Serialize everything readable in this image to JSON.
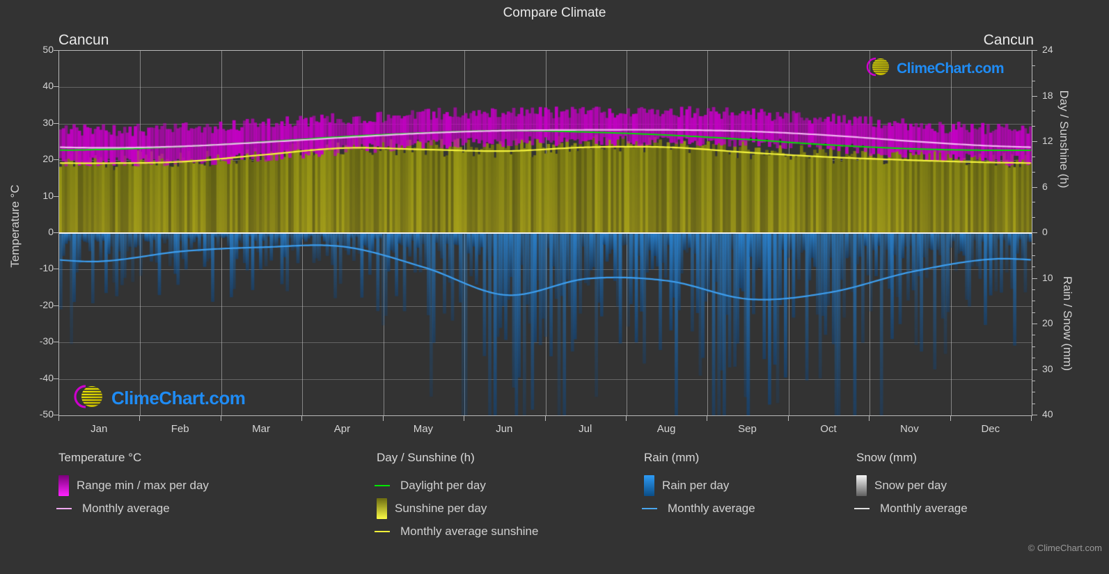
{
  "header": {
    "title": "Compare Climate",
    "city_left": "Cancun",
    "city_right": "Cancun"
  },
  "axes": {
    "left_title": "Temperature °C",
    "right_top_title": "Day / Sunshine (h)",
    "right_bottom_title": "Rain / Snow (mm)",
    "left_ticks": [
      "50",
      "40",
      "30",
      "20",
      "10",
      "0",
      "-10",
      "-20",
      "-30",
      "-40",
      "-50"
    ],
    "right_top_ticks": [
      "24",
      "18",
      "12",
      "6",
      "0"
    ],
    "right_bottom_ticks": [
      "0",
      "10",
      "20",
      "30",
      "40"
    ],
    "x_ticks": [
      "Jan",
      "Feb",
      "Mar",
      "Apr",
      "May",
      "Jun",
      "Jul",
      "Aug",
      "Sep",
      "Oct",
      "Nov",
      "Dec"
    ]
  },
  "legend": {
    "columns": [
      {
        "heading": "Temperature °C",
        "entries": [
          {
            "label": "Range min / max per day",
            "style": "box",
            "color": "#cc00cc"
          },
          {
            "label": "Monthly average",
            "style": "line",
            "color": "#f0a8f0"
          }
        ]
      },
      {
        "heading": "Day / Sunshine (h)",
        "entries": [
          {
            "label": "Daylight per day",
            "style": "line",
            "color": "#00e800"
          },
          {
            "label": "Sunshine per day",
            "style": "box",
            "color": "#eaea22"
          },
          {
            "label": "Monthly average sunshine",
            "style": "line",
            "color": "#f2f23a"
          }
        ]
      },
      {
        "heading": "Rain (mm)",
        "entries": [
          {
            "label": "Rain per day",
            "style": "box",
            "color": "#1a86e0"
          },
          {
            "label": "Monthly average",
            "style": "line",
            "color": "#4aa6ee"
          }
        ]
      },
      {
        "heading": "Snow (mm)",
        "entries": [
          {
            "label": "Snow per day",
            "style": "box",
            "color": "#e8e8e8"
          },
          {
            "label": "Monthly average",
            "style": "line",
            "color": "#e0e0e0"
          }
        ]
      }
    ],
    "copyright": "© ClimeChart.com"
  },
  "branding": {
    "logo_text": "ClimeChart.com",
    "logo_ring_color": "#cc00cc",
    "logo_sphere_color": "#e0e000",
    "logo_text_color": "#1f8cf5"
  },
  "chart_data": {
    "type": "area",
    "title": "Compare Climate",
    "location": "Cancun",
    "xlabel": "",
    "categories": [
      "Jan",
      "Feb",
      "Mar",
      "Apr",
      "May",
      "Jun",
      "Jul",
      "Aug",
      "Sep",
      "Oct",
      "Nov",
      "Dec"
    ],
    "axes": {
      "temperature_ylim": [
        -50,
        50
      ],
      "temperature_unit": "°C",
      "day_sunshine_ylim": [
        0,
        24
      ],
      "day_sunshine_unit": "h",
      "rain_snow_ylim": [
        0,
        40
      ],
      "rain_snow_unit": "mm",
      "grid": true
    },
    "series": [
      {
        "name": "Temperature monthly average",
        "unit": "°C",
        "color": "#f0a8f0",
        "values": [
          23.4,
          23.8,
          24.9,
          26.2,
          27.4,
          28.1,
          28.3,
          28.3,
          27.9,
          26.8,
          25.2,
          23.9
        ]
      },
      {
        "name": "Temperature range max per day",
        "unit": "°C",
        "color": "#cc00cc",
        "values": [
          28.0,
          28.5,
          29.8,
          31.2,
          32.4,
          32.8,
          33.0,
          33.1,
          32.4,
          31.0,
          29.5,
          28.3
        ]
      },
      {
        "name": "Temperature range min per day",
        "unit": "°C",
        "color": "#cc00cc",
        "values": [
          19.2,
          19.6,
          20.9,
          22.6,
          24.2,
          25.0,
          25.1,
          25.1,
          24.6,
          23.4,
          21.5,
          19.9
        ]
      },
      {
        "name": "Daylight per day",
        "unit": "h",
        "color": "#00e800",
        "values": [
          11.0,
          11.4,
          12.0,
          12.7,
          13.2,
          13.5,
          13.3,
          12.9,
          12.3,
          11.6,
          11.1,
          10.9
        ]
      },
      {
        "name": "Monthly average sunshine",
        "unit": "h",
        "color": "#f2f23a",
        "values": [
          9.2,
          9.4,
          10.3,
          11.2,
          11.0,
          10.8,
          11.3,
          11.3,
          10.6,
          10.0,
          9.6,
          9.3
        ]
      },
      {
        "name": "Rain monthly average",
        "unit": "mm",
        "color": "#4aa6ee",
        "values": [
          6.2,
          4.0,
          3.1,
          3.0,
          7.6,
          13.6,
          10.0,
          10.5,
          14.5,
          13.0,
          8.5,
          5.7
        ]
      },
      {
        "name": "Snow monthly average",
        "unit": "mm",
        "color": "#e0e0e0",
        "values": [
          0,
          0,
          0,
          0,
          0,
          0,
          0,
          0,
          0,
          0,
          0,
          0
        ]
      }
    ]
  }
}
